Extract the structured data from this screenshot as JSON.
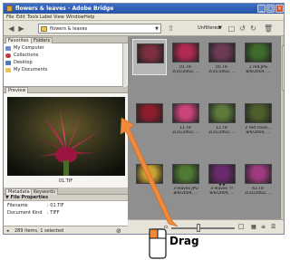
{
  "window": {
    "title": "flowers & leaves - Adobe Bridge",
    "minimize": "_",
    "maximize": "□",
    "close": "×"
  },
  "menu": [
    "File",
    "Edit",
    "Tools",
    "Label",
    "View",
    "Window",
    "Help"
  ],
  "toolbar": {
    "path": "flowers & leaves",
    "filter": "Unfiltered",
    "icons": [
      "back-icon",
      "forward-icon",
      "folder-up-icon",
      "rotate-left-icon",
      "rotate-right-icon",
      "delete-icon",
      "trash-icon"
    ]
  },
  "left_panel": {
    "tabs": {
      "favorites": "Favorites",
      "folders": "Folders"
    },
    "favorites": [
      "My Computer",
      "Collections",
      "Desktop",
      "My Documents"
    ],
    "preview_tab": "Preview",
    "preview_caption": "01.TIF",
    "meta_tabs": {
      "metadata": "Metadata",
      "keywords": "Keywords"
    },
    "file_properties": {
      "header": "File Properties",
      "rows": [
        {
          "label": "Filename",
          "value": ": 01.TIF"
        },
        {
          "label": "Document Kind",
          "value": ": TIFF"
        }
      ]
    },
    "status": "289 items, 1 selected"
  },
  "thumbnails": [
    {
      "name": "",
      "date": "",
      "selected": true,
      "color": "#7b2f3f",
      "rating": 0
    },
    {
      "name": "01.TIF",
      "date": "3/31/2002, ...",
      "selected": false,
      "color": "#b02a52",
      "rating": 0
    },
    {
      "name": "05.TIF",
      "date": "3/31/2002, ...",
      "selected": false,
      "color": "#6d3a54",
      "rating": 0
    },
    {
      "name": "1 red.JPG",
      "date": "8/6/2004, ...",
      "selected": false,
      "color": "#3f6b2c",
      "rating": 0
    },
    {
      "name": "",
      "date": "",
      "selected": false,
      "color": "#8a1e2c",
      "rating": 0
    },
    {
      "name": "11.TIF",
      "date": "3/31/2002, ...",
      "selected": false,
      "color": "#c9447a",
      "rating": 0
    },
    {
      "name": "12.TIF",
      "date": "3/31/2002, ...",
      "selected": false,
      "color": "#5c7a3a",
      "rating": 0
    },
    {
      "name": "2 red roses...",
      "date": "8/6/2004, ...",
      "selected": false,
      "color": "#4d5f2c",
      "rating": 0
    },
    {
      "name": "",
      "date": "",
      "selected": false,
      "color": "#c7a233",
      "rating": 0
    },
    {
      "name": "3 leaves.JPG",
      "date": "8/6/2004, ...",
      "selected": false,
      "color": "#4f7a33",
      "rating": 0
    },
    {
      "name": "3 leaves !!!",
      "date": "8/6/2004, ...",
      "selected": false,
      "color": "#6a2a6e",
      "rating": 2
    },
    {
      "name": "42.TIF",
      "date": "3/31/2002, ...",
      "selected": false,
      "color": "#9e3b7e",
      "rating": 0
    }
  ],
  "callout": {
    "label": "Drag"
  },
  "colors": {
    "accent": "#f08a3a",
    "grid_bg": "#8f8f8f",
    "titlebar": "#2553a7"
  }
}
